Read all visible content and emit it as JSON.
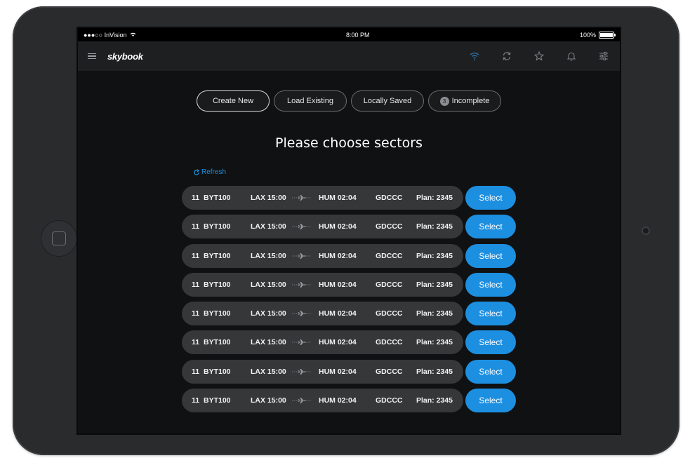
{
  "status_bar": {
    "carrier": "●●●○○ InVision",
    "time": "8:00 PM",
    "battery": "100%"
  },
  "app": {
    "logo": "skybook",
    "header_icons": [
      "wifi-icon",
      "sync-icon",
      "star-icon",
      "bell-icon",
      "filter-sliders-icon"
    ]
  },
  "segments": [
    {
      "label": "Create New",
      "active": true
    },
    {
      "label": "Load Existing"
    },
    {
      "label": "Locally Saved"
    },
    {
      "label": "Incomplete",
      "badge": "3"
    }
  ],
  "page_title": "Please choose sectors",
  "refresh_label": "Refresh",
  "sectors": [
    {
      "num": "11",
      "flight": "BYT100",
      "from": "LAX 15:00",
      "to": "HUM 02:04",
      "reg": "GDCCC",
      "plan": "Plan: 2345",
      "action": "Select"
    },
    {
      "num": "11",
      "flight": "BYT100",
      "from": "LAX 15:00",
      "to": "HUM 02:04",
      "reg": "GDCCC",
      "plan": "Plan: 2345",
      "action": "Select"
    },
    {
      "num": "11",
      "flight": "BYT100",
      "from": "LAX 15:00",
      "to": "HUM 02:04",
      "reg": "GDCCC",
      "plan": "Plan: 2345",
      "action": "Select"
    },
    {
      "num": "11",
      "flight": "BYT100",
      "from": "LAX 15:00",
      "to": "HUM 02:04",
      "reg": "GDCCC",
      "plan": "Plan: 2345",
      "action": "Select"
    },
    {
      "num": "11",
      "flight": "BYT100",
      "from": "LAX 15:00",
      "to": "HUM 02:04",
      "reg": "GDCCC",
      "plan": "Plan: 2345",
      "action": "Select"
    },
    {
      "num": "11",
      "flight": "BYT100",
      "from": "LAX 15:00",
      "to": "HUM 02:04",
      "reg": "GDCCC",
      "plan": "Plan: 2345",
      "action": "Select"
    },
    {
      "num": "11",
      "flight": "BYT100",
      "from": "LAX 15:00",
      "to": "HUM 02:04",
      "reg": "GDCCC",
      "plan": "Plan: 2345",
      "action": "Select"
    },
    {
      "num": "11",
      "flight": "BYT100",
      "from": "LAX 15:00",
      "to": "HUM 02:04",
      "reg": "GDCCC",
      "plan": "Plan: 2345",
      "action": "Select"
    }
  ],
  "colors": {
    "accent": "#1d8fe1",
    "background": "#101112",
    "row": "#363739"
  }
}
